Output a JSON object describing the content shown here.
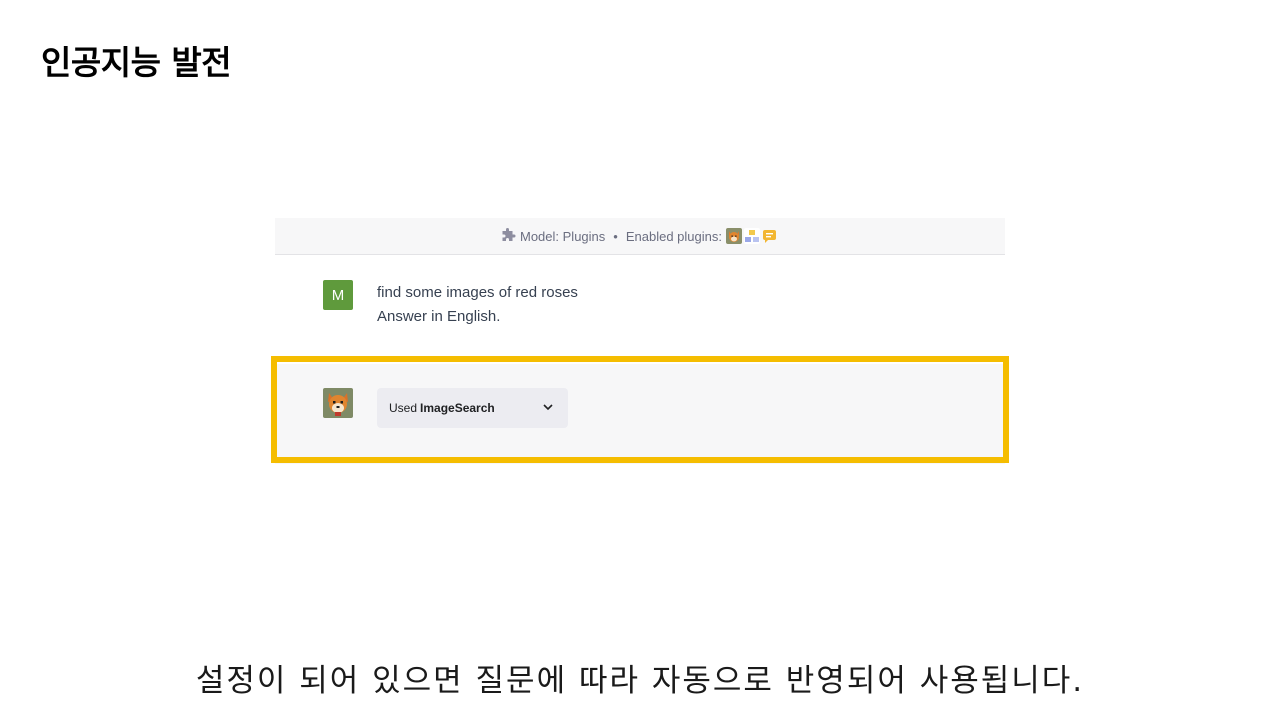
{
  "slide": {
    "title": "인공지능 발전",
    "caption": "설정이 되어 있으면 질문에 따라 자동으로 반영되어 사용됩니다."
  },
  "model_bar": {
    "model_label": "Model: Plugins",
    "separator": "•",
    "plugins_label": "Enabled plugins:",
    "plugin_icons": [
      "shiba-plugin-icon",
      "blocks-plugin-icon",
      "chat-plugin-icon"
    ]
  },
  "user_message": {
    "avatar_letter": "M",
    "line1": "find some images of red roses",
    "line2": "Answer in English."
  },
  "assistant_message": {
    "used_prefix": "Used",
    "plugin_name": "ImageSearch"
  },
  "colors": {
    "highlight": "#f5bd00",
    "user_avatar": "#5f9a3c",
    "panel_bg": "#f7f7f8"
  }
}
